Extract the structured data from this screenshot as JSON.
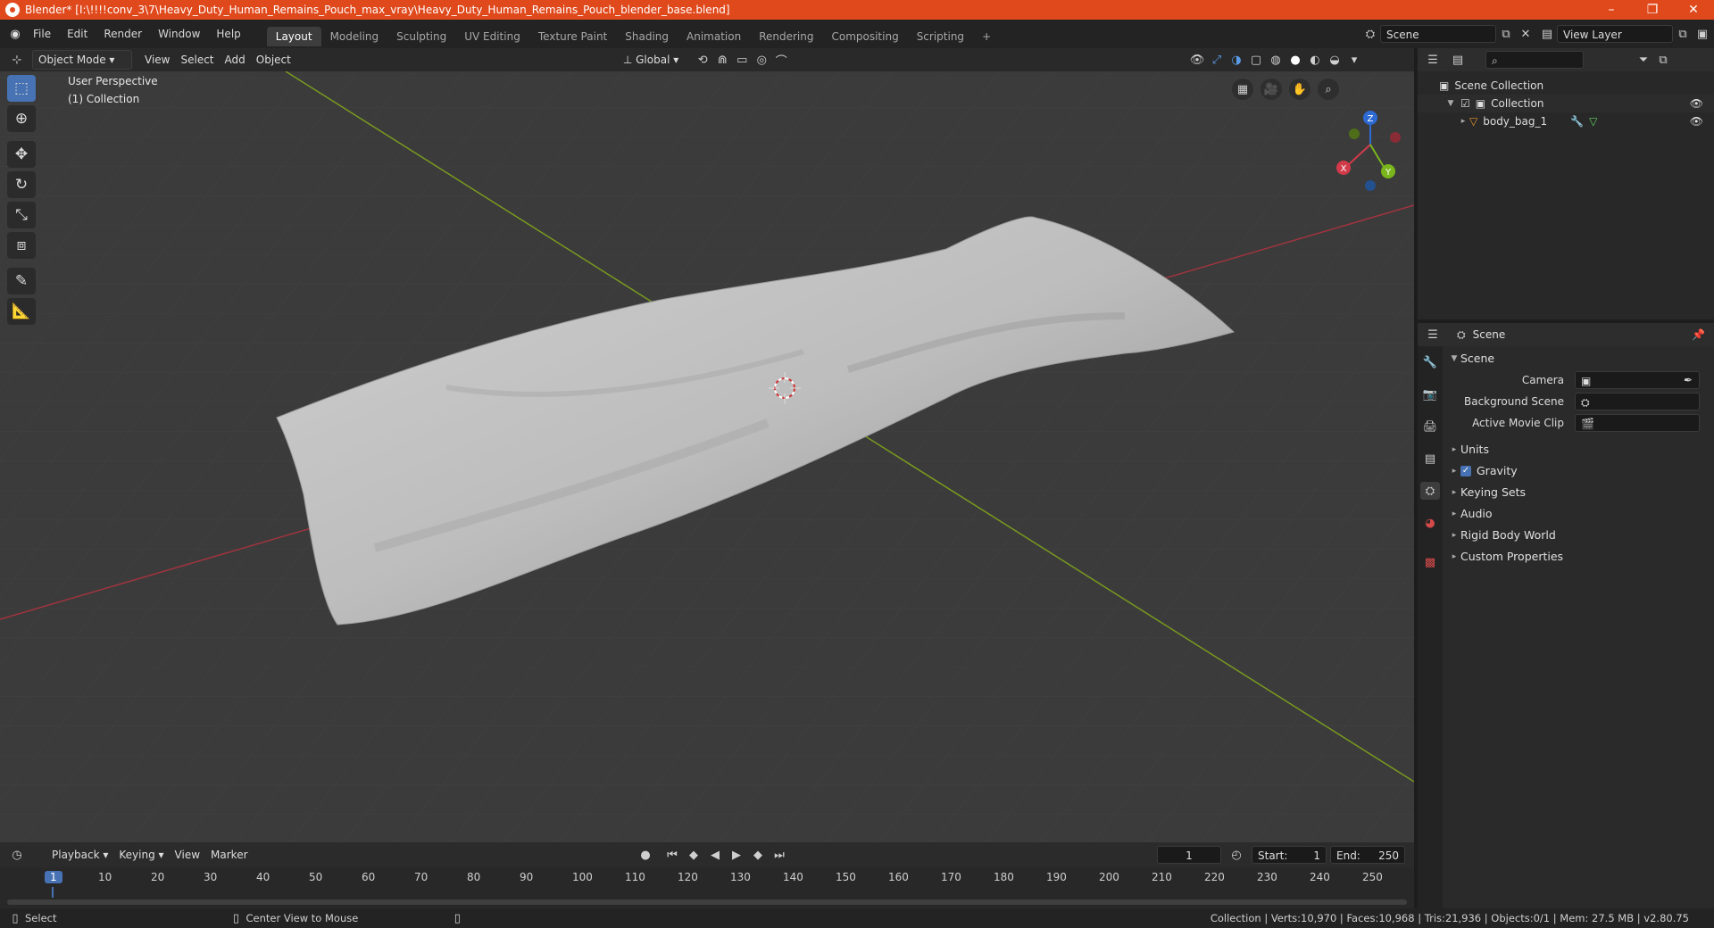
{
  "window": {
    "title": "Blender* [I:\\!!!!conv_3\\7\\Heavy_Duty_Human_Remains_Pouch_max_vray\\Heavy_Duty_Human_Remains_Pouch_blender_base.blend]",
    "minimize": "–",
    "maximize": "❐",
    "close": "✕"
  },
  "menu": [
    "File",
    "Edit",
    "Render",
    "Window",
    "Help"
  ],
  "workspaces": [
    "Layout",
    "Modeling",
    "Sculpting",
    "UV Editing",
    "Texture Paint",
    "Shading",
    "Animation",
    "Rendering",
    "Compositing",
    "Scripting"
  ],
  "workspace_add": "+",
  "scene_field": "Scene",
  "view_layer_field": "View Layer",
  "viewport": {
    "mode": "Object Mode",
    "menus": [
      "View",
      "Select",
      "Add",
      "Object"
    ],
    "transform": "Global",
    "label_line1": "User Perspective",
    "label_line2": "(1) Collection",
    "gizmo_axes": {
      "x": "X",
      "y": "Y",
      "z": "Z"
    },
    "colors": {
      "x_axis": "#a1343e",
      "y_axis": "#7a9a1f",
      "object": "#bdbdbd",
      "select": "#4772b3"
    }
  },
  "outliner": {
    "scene_collection": "Scene Collection",
    "collection": "Collection",
    "object": "body_bag_1"
  },
  "properties": {
    "tab": "Scene",
    "section": "Scene",
    "camera_label": "Camera",
    "background_scene_label": "Background Scene",
    "active_movie_clip_label": "Active Movie Clip",
    "panels": [
      "Units",
      "Gravity",
      "Keying Sets",
      "Audio",
      "Rigid Body World",
      "Custom Properties"
    ],
    "gravity_checked": true
  },
  "timeline": {
    "menus": [
      "Playback",
      "Keying",
      "View",
      "Marker"
    ],
    "current_frame": "1",
    "start_label": "Start:",
    "start": "1",
    "end_label": "End:",
    "end": "250",
    "ruler": [
      "1",
      "10",
      "20",
      "30",
      "40",
      "50",
      "60",
      "70",
      "80",
      "90",
      "100",
      "110",
      "120",
      "130",
      "140",
      "150",
      "160",
      "170",
      "180",
      "190",
      "200",
      "210",
      "220",
      "230",
      "240",
      "250"
    ]
  },
  "statusbar": {
    "select": "Select",
    "center_view": "Center View to Mouse",
    "stats": "Collection | Verts:10,970 | Faces:10,968 | Tris:21,936 | Objects:0/1 | Mem: 27.5 MB | v2.80.75"
  }
}
